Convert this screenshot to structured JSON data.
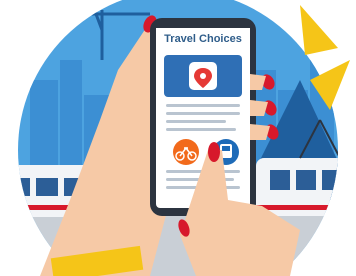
{
  "illustration": {
    "app_title": "Travel Choices",
    "icons": [
      "map-pin-icon",
      "bicycle-icon",
      "bus-icon"
    ],
    "colors": {
      "sky_blue": "#4da3e0",
      "dark_blue": "#1f5f9e",
      "phone_frame": "#2c3440",
      "app_header": "#2f6fb5",
      "pin_red": "#e53935",
      "bike_orange": "#f26a1b",
      "bus_blue": "#1e6bb8",
      "nail_red": "#d7192b",
      "skin": "#f6c9a6",
      "accent_yellow": "#f5c518",
      "train_white": "#f2f4f7"
    }
  }
}
